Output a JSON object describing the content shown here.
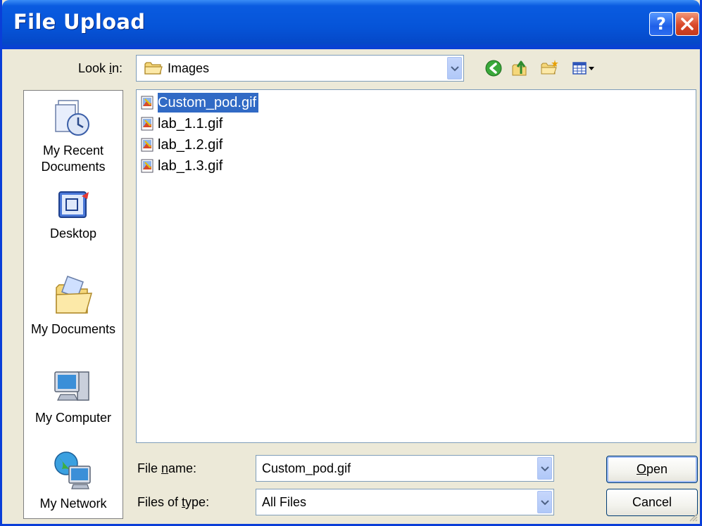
{
  "window": {
    "title": "File Upload"
  },
  "titlebar": {
    "help_label": "?",
    "close_label": "✕"
  },
  "lookin": {
    "label_pre": "Look ",
    "label_ul": "i",
    "label_post": "n:",
    "value": "Images",
    "icon": "folder-icon"
  },
  "toolbar": {
    "icons": [
      "back-icon",
      "up-folder-icon",
      "new-folder-icon",
      "view-menu-icon"
    ]
  },
  "places": [
    {
      "label": "My Recent\nDocuments",
      "line1": "My Recent",
      "line2": "Documents",
      "icon": "recent-documents-icon"
    },
    {
      "label": "Desktop",
      "icon": "desktop-icon"
    },
    {
      "label": "My Documents",
      "icon": "my-documents-icon"
    },
    {
      "label": "My Computer",
      "icon": "my-computer-icon"
    },
    {
      "label": "My Network",
      "icon": "my-network-icon"
    }
  ],
  "files": [
    {
      "name": "Custom_pod.gif",
      "selected": true
    },
    {
      "name": "lab_1.1.gif",
      "selected": false
    },
    {
      "name": "lab_1.2.gif",
      "selected": false
    },
    {
      "name": "lab_1.3.gif",
      "selected": false
    }
  ],
  "filename": {
    "label_pre": "File ",
    "label_ul": "n",
    "label_post": "ame:",
    "value": "Custom_pod.gif"
  },
  "filetype": {
    "label_pre": "Files of ",
    "label_ul": "t",
    "label_post": "ype:",
    "value": "All Files"
  },
  "buttons": {
    "open_ul": "O",
    "open_rest": "pen",
    "cancel": "Cancel"
  },
  "colors": {
    "titlebar": "#0654d8",
    "selection": "#316ac5",
    "dialog_bg": "#ece9d8"
  }
}
